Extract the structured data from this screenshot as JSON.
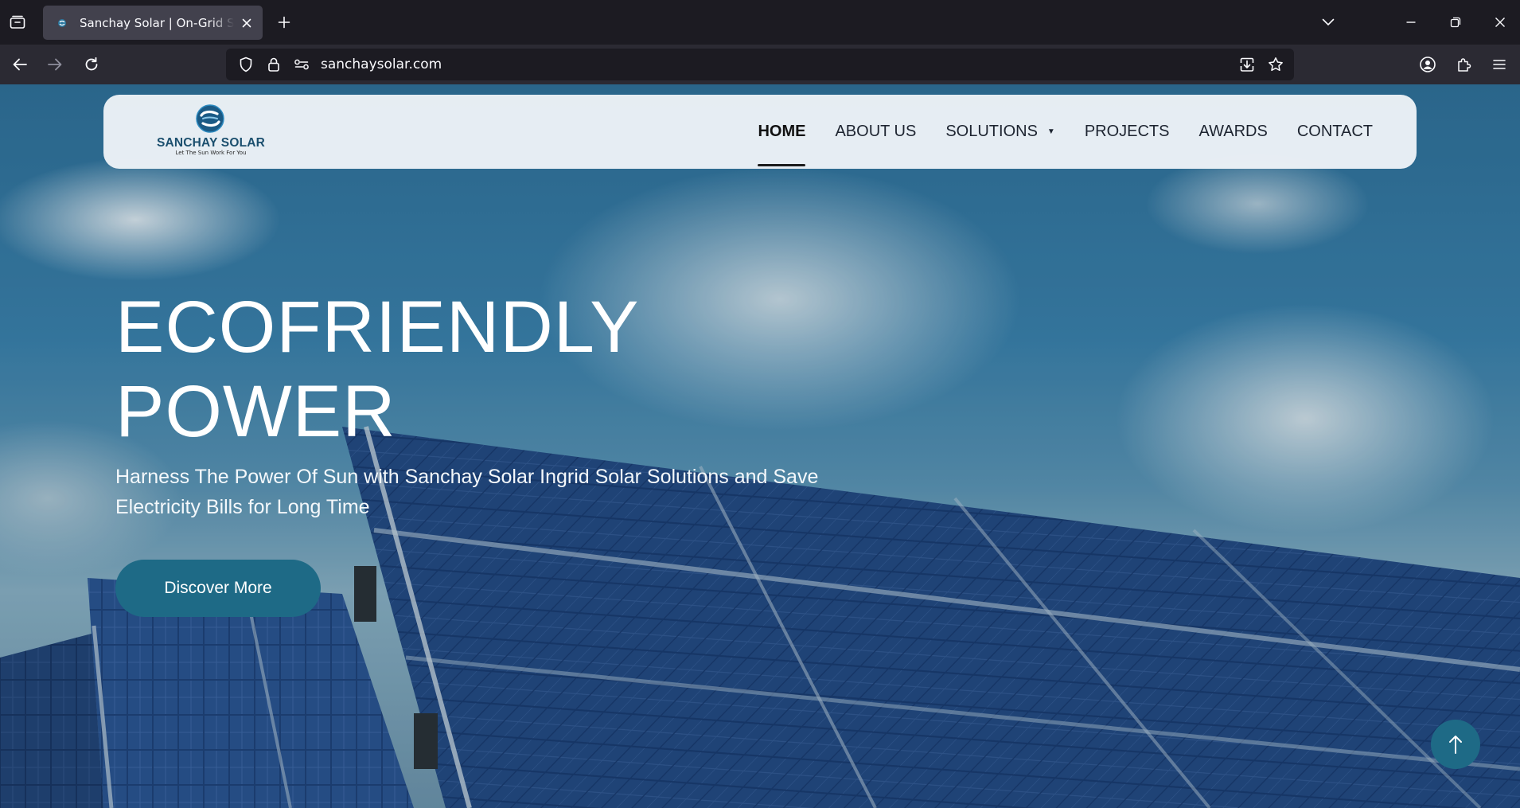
{
  "browser": {
    "tab_title": "Sanchay Solar | On-Grid Solar Power",
    "url": "sanchaysolar.com"
  },
  "site": {
    "logo_name": "SANCHAY SOLAR",
    "logo_tagline": "Let The Sun Work For You",
    "menu": [
      {
        "label": "HOME",
        "active": true
      },
      {
        "label": "ABOUT US"
      },
      {
        "label": "SOLUTIONS",
        "has_dropdown": true
      },
      {
        "label": "PROJECTS"
      },
      {
        "label": "AWARDS"
      },
      {
        "label": "CONTACT"
      }
    ],
    "dropdown_caret": "▼",
    "hero": {
      "title_line1": "ECOFRIENDLY",
      "title_line2": "POWER",
      "subtitle": "Harness The Power Of Sun with Sanchay Solar Ingrid Solar Solutions and Save Electricity Bills for Long Time",
      "cta_label": "Discover More"
    }
  },
  "colors": {
    "brand": "#1e6a86",
    "chrome_bg": "#1c1b22",
    "toolbar_bg": "#2b2a33",
    "active_tab": "#42414d"
  },
  "icons": {
    "scroll_top": "arrow-up-icon"
  }
}
